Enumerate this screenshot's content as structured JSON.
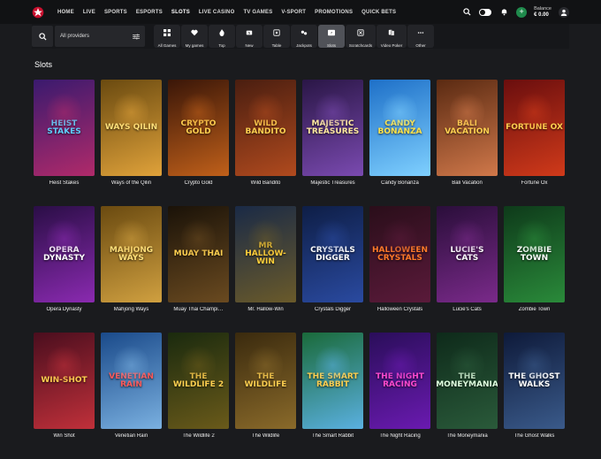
{
  "nav": {
    "items": [
      "HOME",
      "LIVE",
      "SPORTS",
      "ESPORTS",
      "SLOTS",
      "LIVE CASINO",
      "TV GAMES",
      "V-SPORT",
      "PROMOTIONS",
      "QUICK BETS"
    ],
    "active": "SLOTS"
  },
  "account": {
    "balance_label": "Balance",
    "balance_value": "€ 0.00"
  },
  "filters": {
    "provider": "All providers",
    "categories": [
      "All Games",
      "My games",
      "Top",
      "New",
      "Table",
      "Jackpots",
      "Slots",
      "Scratchcards",
      "Video Poker",
      "Other"
    ],
    "active_category": "Slots"
  },
  "section_title": "Slots",
  "games": [
    {
      "name": "Heist Stakes",
      "art": "HEIST STAKES",
      "c1": "#3a1a6e",
      "c2": "#b02a6a",
      "t": "#5fd0ff"
    },
    {
      "name": "Ways of the Qilin",
      "art": "WAYS QILIN",
      "c1": "#6a4a10",
      "c2": "#e0a23a",
      "t": "#ffe07a"
    },
    {
      "name": "Crypto Gold",
      "art": "CRYPTO GOLD",
      "c1": "#3a1608",
      "c2": "#c0601a",
      "t": "#ffd050"
    },
    {
      "name": "Wild Bandito",
      "art": "WILD BANDITO",
      "c1": "#4a1e10",
      "c2": "#b04a1e",
      "t": "#ffd050"
    },
    {
      "name": "Majestic Treasures",
      "art": "MAJESTIC TREASURES",
      "c1": "#2a1646",
      "c2": "#7a4ab0",
      "t": "#ffe9a0"
    },
    {
      "name": "Candy Bonanza",
      "art": "CANDY BONANZA",
      "c1": "#1e70c8",
      "c2": "#7fd0ff",
      "t": "#ffe34a"
    },
    {
      "name": "Bali Vacation",
      "art": "BALI VACATION",
      "c1": "#5a2a12",
      "c2": "#d0784a",
      "t": "#ffd050"
    },
    {
      "name": "Fortune Ox",
      "art": "FORTUNE OX",
      "c1": "#6a0e0e",
      "c2": "#d03a1a",
      "t": "#ffd050"
    },
    {
      "name": "Opera Dynasty",
      "art": "OPERA DYNASTY",
      "c1": "#2a0e46",
      "c2": "#8a2ab0",
      "t": "#ffffff"
    },
    {
      "name": "Mahjong Ways",
      "art": "MAHJONG WAYS",
      "c1": "#6a4a10",
      "c2": "#d0a040",
      "t": "#ffe07a"
    },
    {
      "name": "Muay Thai Champi…",
      "art": "MUAY THAI",
      "c1": "#1a1208",
      "c2": "#6a4a20",
      "t": "#ffd050"
    },
    {
      "name": "Mr. Hallow-Win",
      "art": "MR HALLOW-WIN",
      "c1": "#1a2a46",
      "c2": "#6a5a2a",
      "t": "#ffcf3a"
    },
    {
      "name": "Crystals Digger",
      "art": "CRYSTALS DIGGER",
      "c1": "#0e1e46",
      "c2": "#2a4aa0",
      "t": "#ffffff"
    },
    {
      "name": "Halloween Crystals",
      "art": "HALLOWEEN CRYSTALS",
      "c1": "#2a0e1a",
      "c2": "#5a1a3a",
      "t": "#ff7a2a"
    },
    {
      "name": "Lucie's Cats",
      "art": "LUCIE'S CATS",
      "c1": "#2a0e3a",
      "c2": "#7a2a8a",
      "t": "#ffffff"
    },
    {
      "name": "Zombie Town",
      "art": "ZOMBIE TOWN",
      "c1": "#0e3a1a",
      "c2": "#2a8a3a",
      "t": "#ffffff"
    },
    {
      "name": "Win Shot",
      "art": "WIN-SHOT",
      "c1": "#4a0e1e",
      "c2": "#c0303a",
      "t": "#ffd050"
    },
    {
      "name": "Venetian Rain",
      "art": "VENETIAN RAIN",
      "c1": "#1a4a8a",
      "c2": "#7ab0e0",
      "t": "#ff5a5a"
    },
    {
      "name": "The Wildlife 2",
      "art": "THE WILDLIFE 2",
      "c1": "#1a2a0e",
      "c2": "#6a5a1a",
      "t": "#ffd050"
    },
    {
      "name": "The Wildlife",
      "art": "THE WILDLIFE",
      "c1": "#3a2a0e",
      "c2": "#8a6a2a",
      "t": "#ffd050"
    },
    {
      "name": "The Smart Rabbit",
      "art": "THE SMART RABBIT",
      "c1": "#1a6a3a",
      "c2": "#5ab0e0",
      "t": "#ffd050"
    },
    {
      "name": "The Night Racing",
      "art": "THE NIGHT RACING",
      "c1": "#2a0e5a",
      "c2": "#6a1ab0",
      "t": "#ff4ad0"
    },
    {
      "name": "The Moneymania",
      "art": "THE MONEYMANIA",
      "c1": "#0e2a1a",
      "c2": "#2a5a3a",
      "t": "#e0ffe0"
    },
    {
      "name": "The Ghost Walks",
      "art": "THE GHOST WALKS",
      "c1": "#0e1a3a",
      "c2": "#3a5a8a",
      "t": "#ffffff"
    }
  ]
}
